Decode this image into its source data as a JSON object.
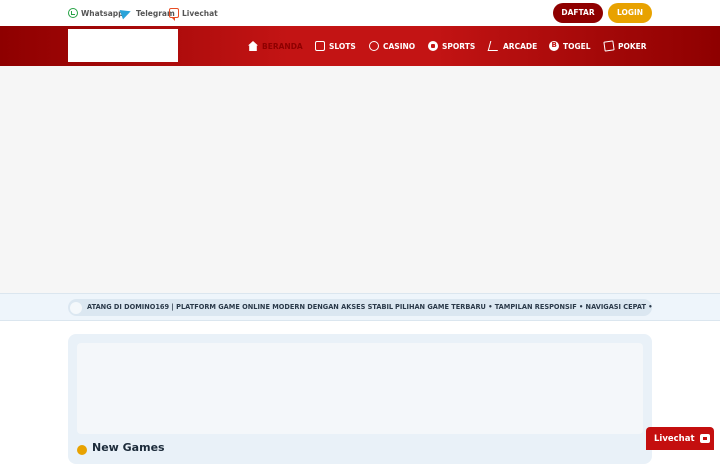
{
  "topbar": {
    "contacts": [
      {
        "label": "Whatsapp",
        "icon": "whatsapp-icon",
        "color": "#25a244"
      },
      {
        "label": "Telegram",
        "icon": "telegram-icon",
        "color": "#2aa3d9"
      },
      {
        "label": "Livechat",
        "icon": "livechat-icon",
        "color": "#e84d24"
      }
    ],
    "daftar_label": "DAFTAR",
    "login_label": "LOGIN"
  },
  "nav": {
    "items": [
      {
        "label": "BERANDA",
        "icon": "home-icon",
        "active": true
      },
      {
        "label": "SLOTS",
        "icon": "slots-icon"
      },
      {
        "label": "CASINO",
        "icon": "casino-chip-icon"
      },
      {
        "label": "SPORTS",
        "icon": "soccer-ball-icon"
      },
      {
        "label": "ARCADE",
        "icon": "arcade-icon"
      },
      {
        "label": "TOGEL",
        "icon": "togel-ball-icon"
      },
      {
        "label": "POKER",
        "icon": "cards-icon"
      }
    ]
  },
  "ticker": {
    "text_1": "ATANG DI DOMINO169 | PLATFORM GAME ONLINE MODERN DENGAN AKSES STABIL",
    "text_2": "PILIHAN GAME TERBARU • TAMPILAN RESPONSIF • NAVIGASI CEPAT • MOB"
  },
  "section": {
    "title": "New Games"
  },
  "livechat": {
    "label": "Livechat"
  },
  "colors": {
    "primary_red": "#c31414",
    "dark_red": "#8e0000",
    "gold": "#e8a200"
  }
}
